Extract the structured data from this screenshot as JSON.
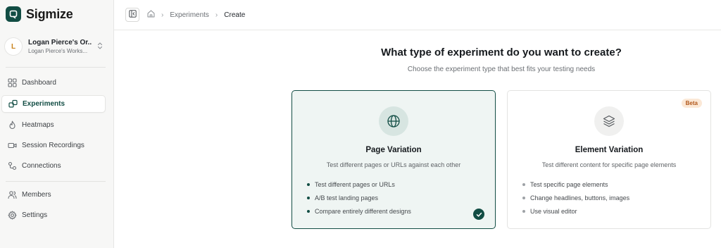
{
  "brand": {
    "name": "Sigmize",
    "color": "#124d44"
  },
  "workspace": {
    "avatar_letter": "L",
    "name": "Logan Pierce's Or...",
    "subtitle": "Logan Pierce's Works..."
  },
  "nav": {
    "primary": [
      {
        "label": "Dashboard",
        "icon": "grid-icon"
      },
      {
        "label": "Experiments",
        "icon": "experiment-icon",
        "active": true
      },
      {
        "label": "Heatmaps",
        "icon": "flame-icon"
      },
      {
        "label": "Session Recordings",
        "icon": "video-icon"
      },
      {
        "label": "Connections",
        "icon": "connections-icon"
      }
    ],
    "secondary": [
      {
        "label": "Members",
        "icon": "users-icon"
      },
      {
        "label": "Settings",
        "icon": "gear-icon"
      }
    ]
  },
  "breadcrumb": {
    "items": [
      "Experiments",
      "Create"
    ]
  },
  "page": {
    "title": "What type of experiment do you want to create?",
    "subtitle": "Choose the experiment type that best fits your testing needs"
  },
  "cards": [
    {
      "title": "Page Variation",
      "description": "Test different pages or URLs against each other",
      "features": [
        "Test different pages or URLs",
        "A/B test landing pages",
        "Compare entirely different designs"
      ],
      "icon": "globe-icon",
      "selected": true
    },
    {
      "title": "Element Variation",
      "description": "Test different content for specific page elements",
      "features": [
        "Test specific page elements",
        "Change headlines, buttons, images",
        "Use visual editor"
      ],
      "icon": "layers-icon",
      "badge": "Beta",
      "selected": false
    }
  ]
}
